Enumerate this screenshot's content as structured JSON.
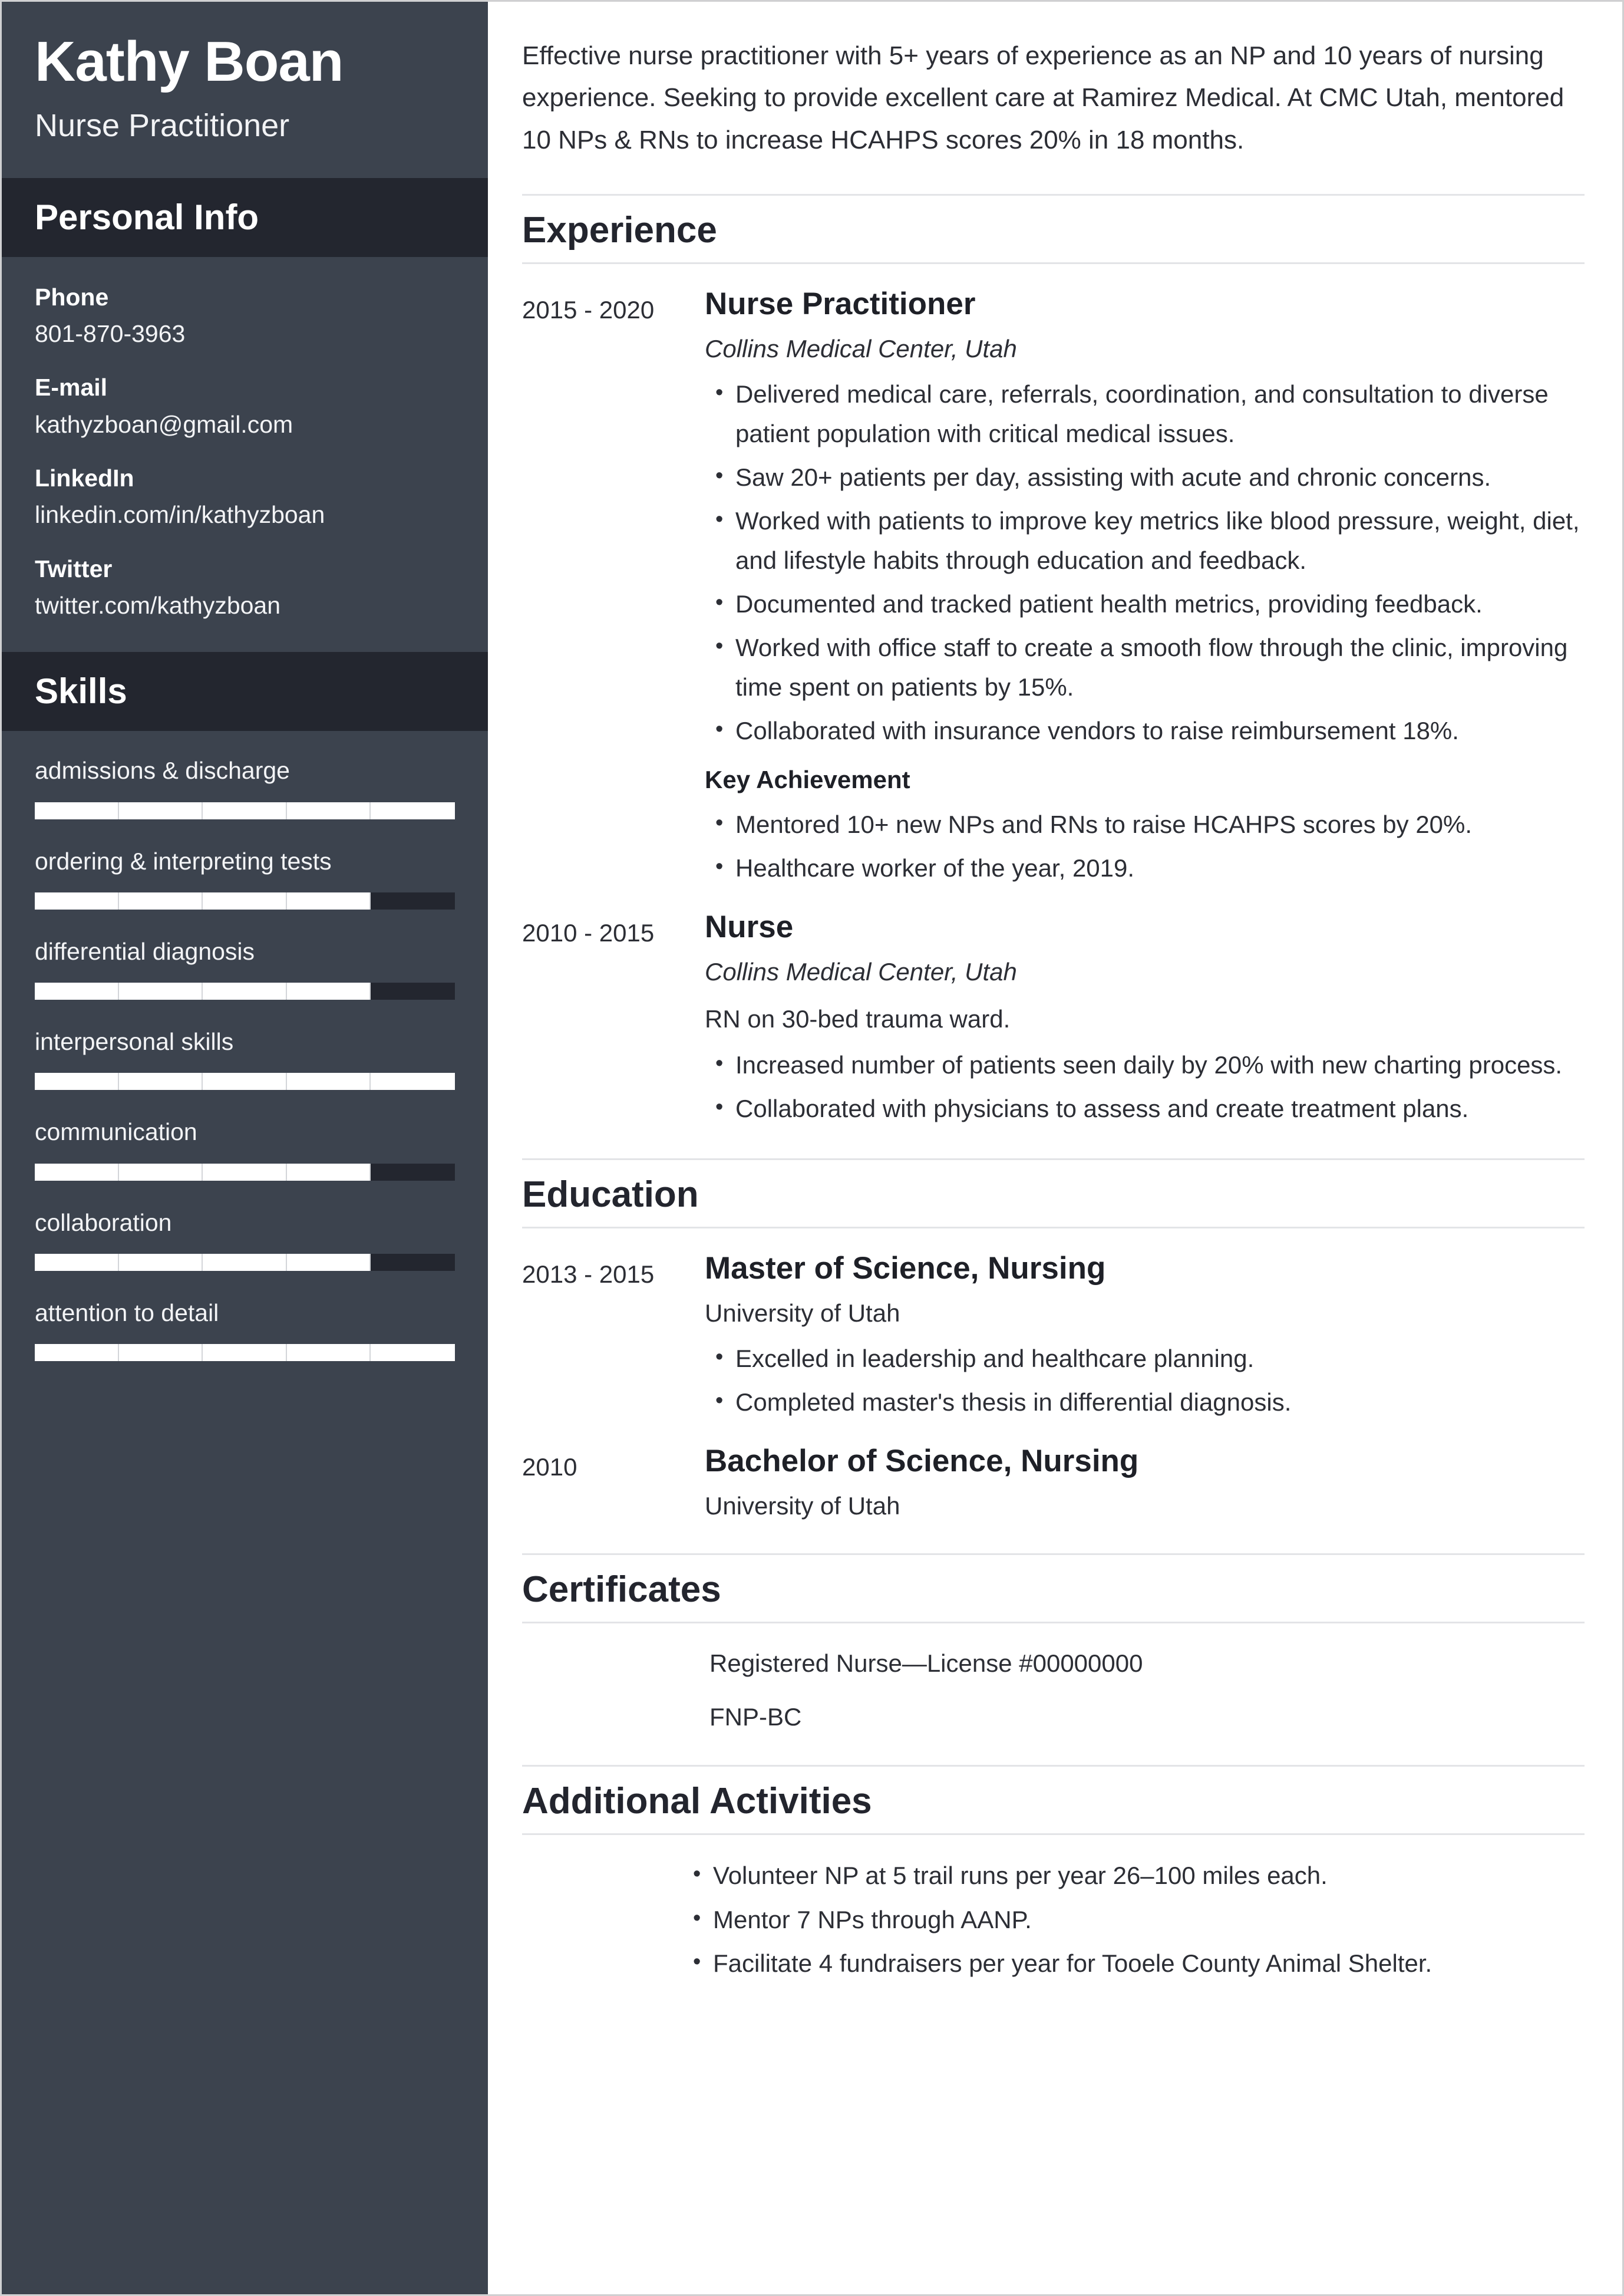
{
  "theme": {
    "sidebar_bg": "#3c434e",
    "sidebar_band_bg": "#23262f",
    "page_bg": "#ffffff",
    "accent_text": "#ffffff",
    "body_text": "#2c2e35",
    "rule": "#e3e4e7"
  },
  "sidebar": {
    "name": "Kathy Boan",
    "job_title": "Nurse Practitioner",
    "personal_info_heading": "Personal Info",
    "contacts": [
      {
        "label": "Phone",
        "value": "801-870-3963"
      },
      {
        "label": "E-mail",
        "value": "kathyzboan@gmail.com"
      },
      {
        "label": "LinkedIn",
        "value": "linkedin.com/in/kathyzboan"
      },
      {
        "label": "Twitter",
        "value": "twitter.com/kathyzboan"
      }
    ],
    "skills_heading": "Skills",
    "skills": [
      {
        "name": "admissions & discharge",
        "level": 100
      },
      {
        "name": "ordering & interpreting tests",
        "level": 80
      },
      {
        "name": "differential diagnosis",
        "level": 80
      },
      {
        "name": "interpersonal skills",
        "level": 100
      },
      {
        "name": "communication",
        "level": 80
      },
      {
        "name": "collaboration",
        "level": 80
      },
      {
        "name": "attention to detail",
        "level": 100
      }
    ]
  },
  "main": {
    "summary": "Effective nurse practitioner with 5+ years of experience as an NP and 10 years of nursing experience. Seeking to provide excellent care at Ramirez Medical. At CMC Utah, mentored 10 NPs & RNs to increase HCAHPS scores 20% in 18 months.",
    "experience": {
      "heading": "Experience",
      "entries": [
        {
          "dates": "2015 - 2020",
          "title": "Nurse Practitioner",
          "subtitle": "Collins Medical Center, Utah",
          "bullets": [
            "Delivered medical care, referrals, coordination, and consultation to diverse patient population with critical medical issues.",
            "Saw 20+ patients per day, assisting with acute and chronic concerns.",
            "Worked with patients to improve key metrics like blood pressure, weight, diet, and lifestyle habits through education and feedback.",
            "Documented and tracked patient health metrics, providing feedback.",
            "Worked with office staff to create a smooth flow through the clinic, improving time spent on patients by 15%.",
            "Collaborated with insurance vendors to raise reimbursement 18%."
          ],
          "key_achievement_label": "Key Achievement",
          "key_achievements": [
            "Mentored 10+ new NPs and RNs to raise HCAHPS scores by 20%.",
            "Healthcare worker of the year, 2019."
          ]
        },
        {
          "dates": "2010 - 2015",
          "title": "Nurse",
          "subtitle": "Collins Medical Center, Utah",
          "note": "RN on 30-bed trauma ward.",
          "bullets": [
            "Increased number of patients seen daily by 20% with new charting process.",
            "Collaborated with physicians to assess and create treatment plans."
          ]
        }
      ]
    },
    "education": {
      "heading": "Education",
      "entries": [
        {
          "dates": "2013 - 2015",
          "title": "Master of Science, Nursing",
          "school": "University of Utah",
          "bullets": [
            "Excelled in leadership and healthcare planning.",
            "Completed master's thesis in differential diagnosis."
          ]
        },
        {
          "dates": "2010",
          "title": "Bachelor of Science, Nursing",
          "school": "University of Utah",
          "bullets": []
        }
      ]
    },
    "certificates": {
      "heading": "Certificates",
      "items": [
        "Registered Nurse—License #00000000",
        "FNP-BC"
      ]
    },
    "additional_activities": {
      "heading": "Additional Activities",
      "items": [
        "Volunteer NP at 5 trail runs per year 26–100 miles each.",
        "Mentor 7 NPs through AANP.",
        "Facilitate 4 fundraisers per year for Tooele County Animal Shelter."
      ]
    }
  }
}
